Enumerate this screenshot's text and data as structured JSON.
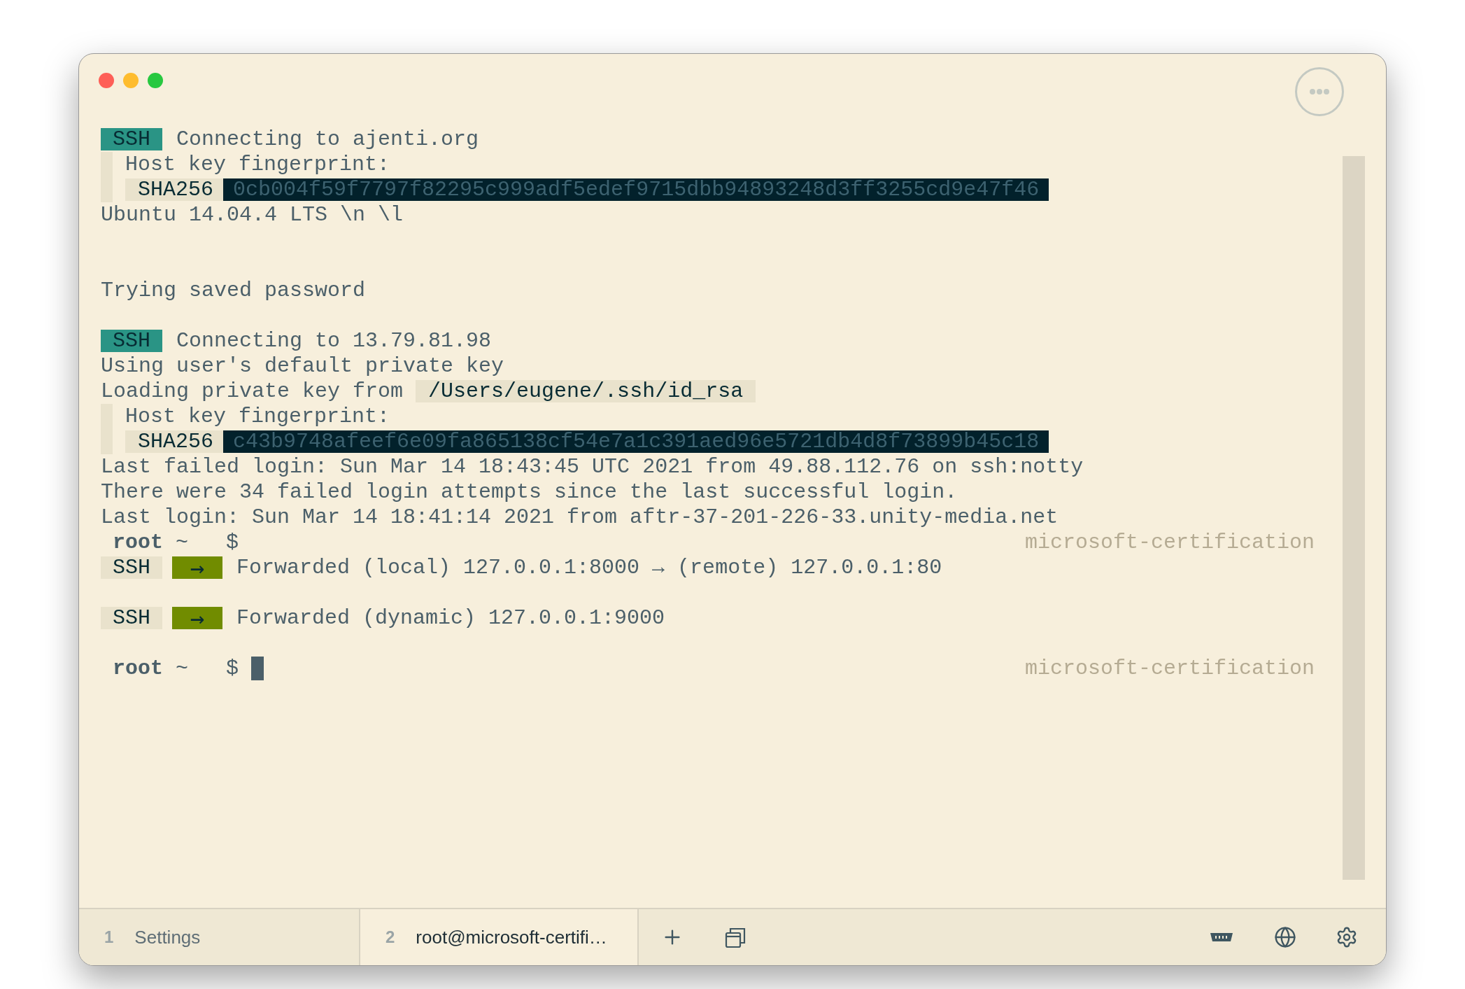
{
  "lines": [
    {
      "kind": "ssh_connect",
      "badge": "SSH",
      "text": "Connecting to ajenti.org"
    },
    {
      "kind": "fingerprint_label",
      "text": "Host key fingerprint:"
    },
    {
      "kind": "fingerprint",
      "algo": "SHA256",
      "hash": "0cb004f59f7797f82295c999adf5edef9715dbb94893248d3ff3255cd9e47f46"
    },
    {
      "kind": "text",
      "text": "Ubuntu 14.04.4 LTS \\n \\l"
    },
    {
      "kind": "blank"
    },
    {
      "kind": "blank"
    },
    {
      "kind": "text",
      "text": "Trying saved password"
    },
    {
      "kind": "blank"
    },
    {
      "kind": "ssh_connect",
      "badge": "SSH",
      "text": "Connecting to 13.79.81.98"
    },
    {
      "kind": "text",
      "text": "Using user's default private key"
    },
    {
      "kind": "text_path",
      "text": "Loading private key from",
      "path": "/Users/eugene/.ssh/id_rsa"
    },
    {
      "kind": "fingerprint_label",
      "text": "Host key fingerprint:"
    },
    {
      "kind": "fingerprint",
      "algo": "SHA256",
      "hash": "c43b9748afeef6e09fa865138cf54e7a1c391aed96e5721db4d8f73899b45c18"
    },
    {
      "kind": "text",
      "text": "Last failed login: Sun Mar 14 18:43:45 UTC 2021 from 49.88.112.76 on ssh:notty"
    },
    {
      "kind": "text",
      "text": "There were 34 failed login attempts since the last successful login."
    },
    {
      "kind": "text",
      "text": "Last login: Sun Mar 14 18:41:14 2021 from aftr-37-201-226-33.unity-media.net"
    },
    {
      "kind": "prompt",
      "user": "root",
      "dir": "~",
      "symbol": "$",
      "host": "microsoft-certification",
      "cursor": false
    },
    {
      "kind": "ssh_forward",
      "badge": "SSH",
      "arrow": "→",
      "text": "Forwarded (local) 127.0.0.1:8000 → (remote) 127.0.0.1:80"
    },
    {
      "kind": "blank"
    },
    {
      "kind": "ssh_forward",
      "badge": "SSH",
      "arrow": "→",
      "text": "Forwarded (dynamic) 127.0.0.1:9000"
    },
    {
      "kind": "blank"
    },
    {
      "kind": "prompt",
      "user": "root",
      "dir": "~",
      "symbol": "$",
      "host": "microsoft-certification",
      "cursor": true
    }
  ],
  "tabs": [
    {
      "number": "1",
      "title": "Settings",
      "selected": false
    },
    {
      "number": "2",
      "title": "root@microsoft-certifi…",
      "selected": true
    }
  ]
}
